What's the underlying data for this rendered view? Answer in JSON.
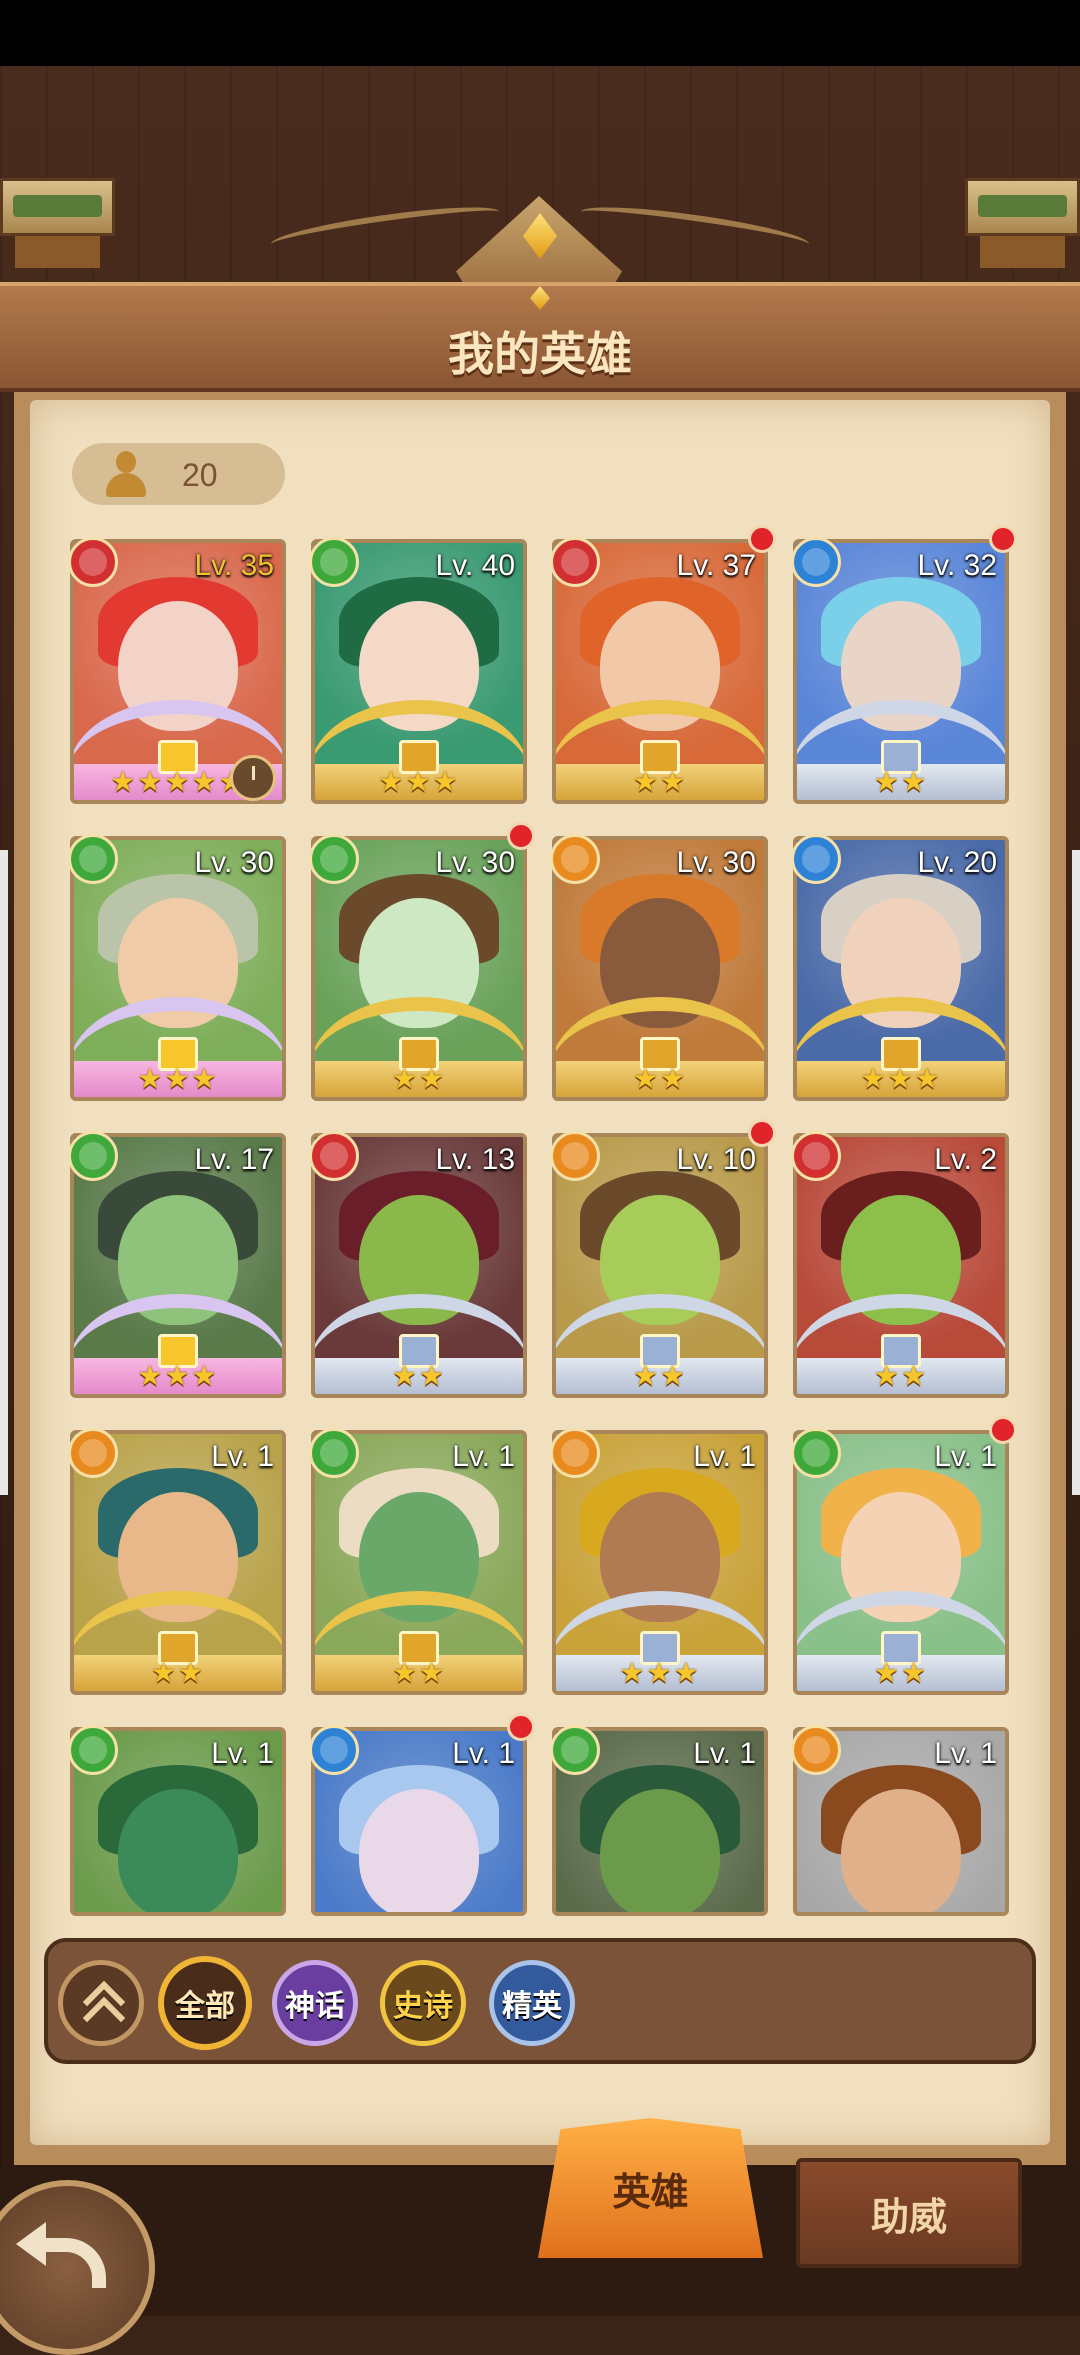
{
  "screen": {
    "title": "我的英雄",
    "hero_count": "20"
  },
  "heroes": [
    {
      "level": "Lv. 35",
      "element": "fire",
      "stars": 5,
      "rarity": "myth",
      "alert": false,
      "timer": true,
      "level_color": "#f0c232",
      "bg": "#d9694d",
      "skin": "#f3d2c8",
      "hair": "#e23a30"
    },
    {
      "level": "Lv. 40",
      "element": "leaf",
      "stars": 3,
      "rarity": "epic",
      "alert": false,
      "bg": "#3a9a72",
      "skin": "#f3d9c6",
      "hair": "#1f6b44"
    },
    {
      "level": "Lv. 37",
      "element": "fire",
      "stars": 2,
      "rarity": "epic",
      "alert": true,
      "bg": "#d86a3a",
      "skin": "#f2c9a8",
      "hair": "#e0642a"
    },
    {
      "level": "Lv. 32",
      "element": "water",
      "stars": 2,
      "rarity": "elite",
      "alert": true,
      "bg": "#5a86d8",
      "skin": "#e9d4c8",
      "hair": "#7ad0e8"
    },
    {
      "level": "Lv. 30",
      "element": "leaf",
      "stars": 3,
      "rarity": "myth",
      "alert": false,
      "bg": "#7fae5a",
      "skin": "#f0cba8",
      "hair": "#b9c4a8"
    },
    {
      "level": "Lv. 30",
      "element": "leaf",
      "stars": 2,
      "rarity": "epic",
      "alert": true,
      "bg": "#6aa25a",
      "skin": "#cfe8c4",
      "hair": "#6a4a2a"
    },
    {
      "level": "Lv. 30",
      "element": "earth",
      "stars": 2,
      "rarity": "epic",
      "alert": false,
      "bg": "#c07a3a",
      "skin": "#8a5a3c",
      "hair": "#d87a2a"
    },
    {
      "level": "Lv. 20",
      "element": "water",
      "stars": 3,
      "rarity": "epic",
      "alert": false,
      "bg": "#4a6aa8",
      "skin": "#f0d2bc",
      "hair": "#d8d0c4"
    },
    {
      "level": "Lv. 17",
      "element": "leaf",
      "stars": 3,
      "rarity": "myth",
      "alert": false,
      "bg": "#5a7a4a",
      "skin": "#8fc27a",
      "hair": "#3a4a3a"
    },
    {
      "level": "Lv. 13",
      "element": "fire",
      "stars": 2,
      "rarity": "elite",
      "alert": false,
      "bg": "#6a3a3a",
      "skin": "#8ab84a",
      "hair": "#6a1e2a"
    },
    {
      "level": "Lv. 10",
      "element": "earth",
      "stars": 2,
      "rarity": "elite",
      "alert": true,
      "bg": "#b89a4a",
      "skin": "#a8cc5a",
      "hair": "#6a4a2a"
    },
    {
      "level": "Lv. 2",
      "element": "fire",
      "stars": 2,
      "rarity": "elite",
      "alert": false,
      "bg": "#b84a3a",
      "skin": "#8cc04a",
      "hair": "#6a1e1e"
    },
    {
      "level": "Lv. 1",
      "element": "earth",
      "stars": 2,
      "rarity": "epic",
      "alert": false,
      "bg": "#b8a24a",
      "skin": "#e8b88a",
      "hair": "#2a6a6a"
    },
    {
      "level": "Lv. 1",
      "element": "leaf",
      "stars": 2,
      "rarity": "epic",
      "alert": false,
      "bg": "#8aa85a",
      "skin": "#6aa86a",
      "hair": "#ecdcc4"
    },
    {
      "level": "Lv. 1",
      "element": "earth",
      "stars": 3,
      "rarity": "elite",
      "alert": false,
      "bg": "#c9a23a",
      "skin": "#b07a52",
      "hair": "#d8a81e"
    },
    {
      "level": "Lv. 1",
      "element": "leaf",
      "stars": 2,
      "rarity": "elite",
      "alert": true,
      "bg": "#8ac08a",
      "skin": "#f6d2b4",
      "hair": "#f2b24a"
    },
    {
      "level": "Lv. 1",
      "element": "leaf",
      "stars": 0,
      "rarity": "elite",
      "alert": false,
      "bg": "#6a9a4a",
      "skin": "#3a8a5a",
      "hair": "#2a6a3a"
    },
    {
      "level": "Lv. 1",
      "element": "water",
      "stars": 0,
      "rarity": "elite",
      "alert": true,
      "bg": "#4a7ac8",
      "skin": "#e8d8e8",
      "hair": "#a8c8f0"
    },
    {
      "level": "Lv. 1",
      "element": "leaf",
      "stars": 0,
      "rarity": "elite",
      "alert": false,
      "bg": "#5a6a4a",
      "skin": "#6a9a4a",
      "hair": "#2a5a3a"
    },
    {
      "level": "Lv. 1",
      "element": "earth",
      "stars": 0,
      "rarity": "elite",
      "alert": false,
      "bg": "#a8a8a8",
      "skin": "#e0b08a",
      "hair": "#8a4a1e"
    }
  ],
  "filters": {
    "all": "全部",
    "myth": "神话",
    "epic": "史诗",
    "elite": "精英"
  },
  "tabs": {
    "heroes": "英雄",
    "support": "助威"
  },
  "colors": {
    "alert": "#e0242a",
    "star": "#f7c62a",
    "accent": "#f0b534"
  }
}
